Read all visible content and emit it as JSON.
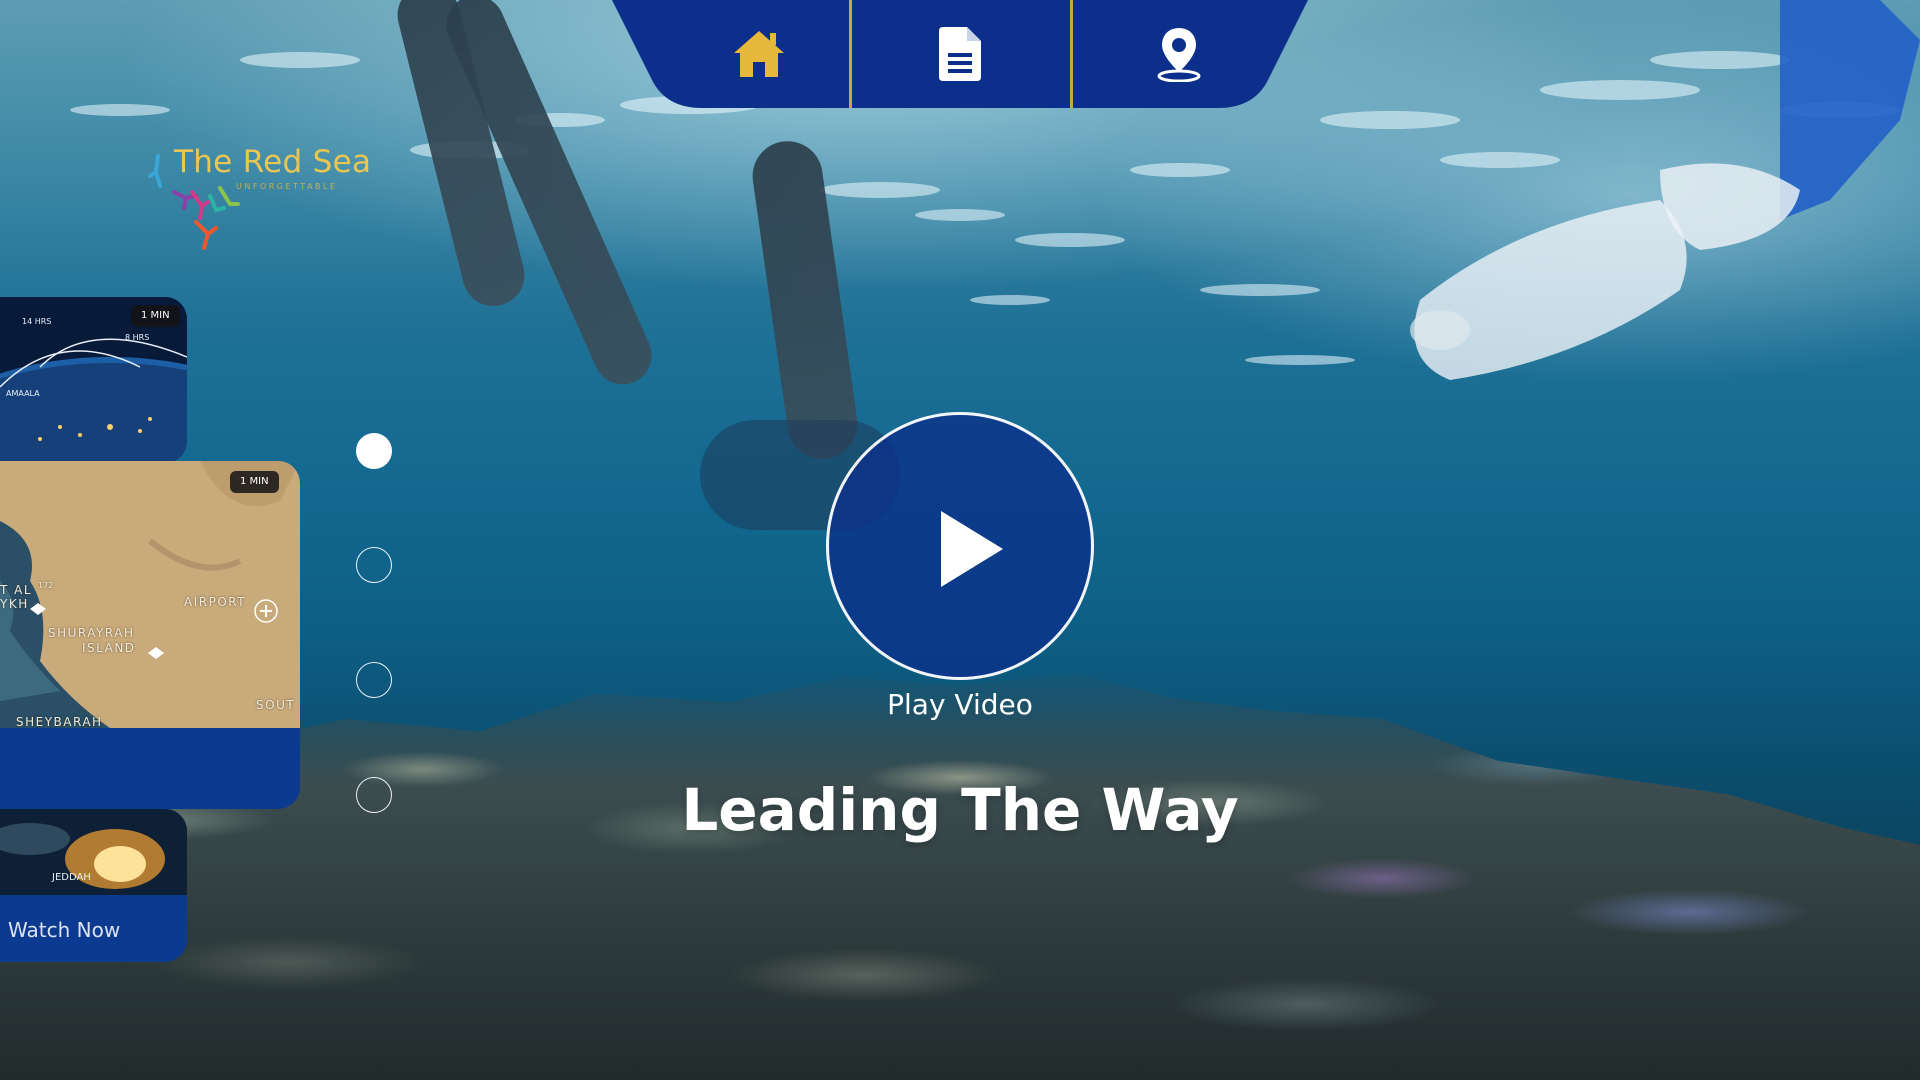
{
  "colors": {
    "nav_background": "#0b2f8a",
    "nav_icon": "#e6b83c",
    "nav_divider": "#c8a93a",
    "brand_gold": "#e9c552",
    "card_blue": "#0c3a90"
  },
  "top_nav": {
    "items": [
      {
        "icon": "home-icon"
      },
      {
        "icon": "document-icon"
      },
      {
        "icon": "location-pin-icon"
      }
    ]
  },
  "logo": {
    "title": "The Red Sea",
    "tagline": "UNFORGETTABLE"
  },
  "video_cards": [
    {
      "badge": "1 MIN",
      "labels": [
        "14 HRS",
        "8 HRS",
        "AMAALA"
      ]
    },
    {
      "badge": "1 MIN",
      "labels": [
        "T AL",
        "YKH",
        "172",
        "AIRPORT",
        "SHURAYRAH",
        "ISLAND",
        "SOUT",
        "SHEYBARAH"
      ]
    },
    {
      "labels": [
        "JEDDAH"
      ],
      "cta": "Watch Now"
    }
  ],
  "pagination": {
    "total": 4,
    "active_index": 0
  },
  "hero": {
    "play_label": "Play Video",
    "headline": "Leading The Way"
  }
}
